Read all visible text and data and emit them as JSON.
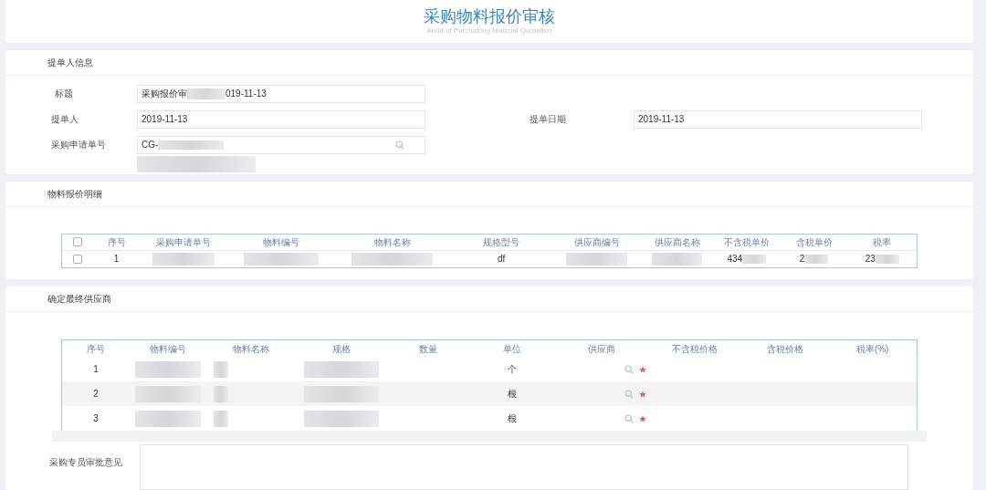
{
  "header": {
    "title": "采购物料报价审核",
    "subtitle": "Audit of Purchasing Material Quotation"
  },
  "submitter": {
    "heading": "提单人信息",
    "title_field": {
      "label": "标题",
      "value_start": "采购报价审",
      "value_end": "019-11-13"
    },
    "submitter_field": {
      "label": "提单人",
      "value": "2019-11-13"
    },
    "date_field": {
      "label": "提单日期",
      "value": "2019-11-13"
    },
    "request_field": {
      "label": "采购申请单号",
      "value": "CG-"
    }
  },
  "quote_details": {
    "heading": "物料报价明细",
    "header_checkbox": {
      "checked": false
    },
    "columns": [
      "序号",
      "采购申请单号",
      "物料编号",
      "物料名称",
      "规格型号",
      "供应商编号",
      "供应商名称",
      "不含税单价",
      "含税单价",
      "税率"
    ],
    "rows": [
      {
        "checked": false,
        "cells": [
          {
            "kind": "text",
            "text": "1"
          },
          {
            "kind": "redacted"
          },
          {
            "kind": "redacted"
          },
          {
            "kind": "redacted"
          },
          {
            "kind": "text",
            "text": "df"
          },
          {
            "kind": "redacted"
          },
          {
            "kind": "redacted"
          },
          {
            "kind": "partial",
            "text": "434"
          },
          {
            "kind": "partial",
            "text": "2"
          },
          {
            "kind": "partial",
            "text": "23"
          }
        ]
      }
    ]
  },
  "final_supplier": {
    "heading": "确定最终供应商",
    "columns": [
      "序号",
      "物料编号",
      "物料名称",
      "规格",
      "数量",
      "单位",
      "供应商",
      "不含税价格",
      "含税价格",
      "税率(%)"
    ],
    "rows": [
      {
        "index": "1",
        "unit": "个"
      },
      {
        "index": "2",
        "unit": "根"
      },
      {
        "index": "3",
        "unit": "根"
      }
    ]
  },
  "approval": {
    "label": "采购专员审批意见"
  }
}
